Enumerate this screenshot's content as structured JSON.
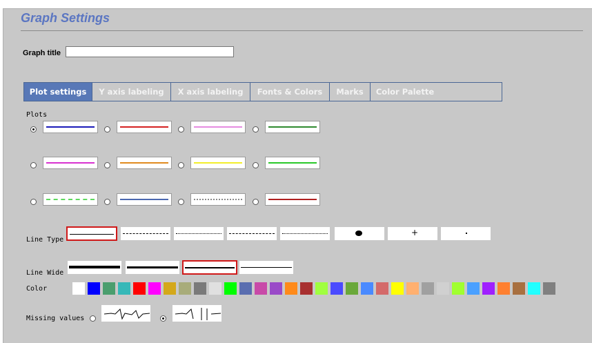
{
  "header": {
    "title": "Graph Settings"
  },
  "graph_title": {
    "label": "Graph title",
    "value": ""
  },
  "tabs": [
    {
      "label": "Plot settings",
      "active": true
    },
    {
      "label": "Y axis labeling",
      "active": false
    },
    {
      "label": "X axis labeling",
      "active": false
    },
    {
      "label": "Fonts & Colors",
      "active": false
    },
    {
      "label": "Marks",
      "active": false
    },
    {
      "label": "Color Palette",
      "active": false
    }
  ],
  "plots": {
    "label": "Plots",
    "selected_index": 0,
    "items": [
      {
        "color": "#1a1ab8",
        "style": "solid"
      },
      {
        "color": "#d42020",
        "style": "solid"
      },
      {
        "color": "#e58be0",
        "style": "solid"
      },
      {
        "color": "#2f8a2f",
        "style": "solid"
      },
      {
        "color": "#d830d0",
        "style": "solid"
      },
      {
        "color": "#e08a1e",
        "style": "solid"
      },
      {
        "color": "#f2ee2a",
        "style": "solid"
      },
      {
        "color": "#28c828",
        "style": "solid"
      },
      {
        "color": "#5ed85e",
        "style": "dashed"
      },
      {
        "color": "#4a68b0",
        "style": "solid"
      },
      {
        "color": "#8a8a8a",
        "style": "dashdot"
      },
      {
        "color": "#b02020",
        "style": "solid"
      }
    ]
  },
  "line_type": {
    "label": "Line Type",
    "selected_index": 0,
    "options": [
      "solid",
      "dashed",
      "dotted",
      "dash-dot",
      "dash-dot-dot",
      "blob",
      "plus",
      "point"
    ]
  },
  "line_wide": {
    "label": "Line Wide",
    "selected_index": 2,
    "options": [
      "thick",
      "medium-thick",
      "medium",
      "thin"
    ]
  },
  "color": {
    "label": "Color",
    "palette": [
      "#ffffff",
      "#0000ff",
      "#4a9e6e",
      "#36b8b8",
      "#ff0000",
      "#ff00ff",
      "#d4a81a",
      "#a8ac7a",
      "#7a7a7a",
      "#e0e0e0",
      "#00ff00",
      "#5a6eb0",
      "#c84aa8",
      "#9a4ac8",
      "#ff8a1a",
      "#a83030",
      "#a0ff40",
      "#4a4aff",
      "#6aa83a",
      "#4a8aff",
      "#d46a6a",
      "#ffff00",
      "#ffb070",
      "#a0a0a0",
      "#d0d0d0",
      "#a0ff30",
      "#4aa0ff",
      "#a020ff",
      "#ff8030",
      "#a87040",
      "#20ffff",
      "#808080"
    ]
  },
  "missing_values": {
    "label": "Missing values",
    "selected_index": 1,
    "options": [
      "connect",
      "gap"
    ]
  }
}
